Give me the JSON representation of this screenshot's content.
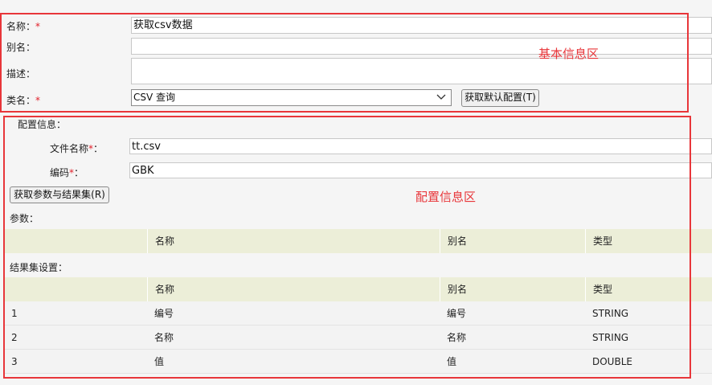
{
  "basic": {
    "name_label": "名称：",
    "name_value": "获取csv数据",
    "alias_label": "别名：",
    "alias_value": "",
    "desc_label": "描述：",
    "desc_value": "",
    "class_label": "类名：",
    "class_value": "CSV 查询",
    "default_config_button": "获取默认配置(T)",
    "required_mark": "*"
  },
  "config": {
    "section_label": "配置信息：",
    "filename_label": "文件名称",
    "filename_value": "tt.csv",
    "encoding_label": "编码",
    "encoding_value": "GBK",
    "colon": "：",
    "fetch_button": "获取参数与结果集(R)",
    "params_label": "参数：",
    "params_columns": [
      "",
      "名称",
      "别名",
      "类型"
    ],
    "result_label": "结果集设置：",
    "result_columns": [
      "",
      "名称",
      "别名",
      "类型"
    ],
    "result_rows": [
      {
        "index": "1",
        "name": "编号",
        "alias": "编号",
        "type": "STRING"
      },
      {
        "index": "2",
        "name": "名称",
        "alias": "名称",
        "type": "STRING"
      },
      {
        "index": "3",
        "name": "值",
        "alias": "值",
        "type": "DOUBLE"
      }
    ]
  },
  "annotations": {
    "basic_area": "基本信息区",
    "config_area": "配置信息区",
    "color": "#e8363a"
  },
  "icons": {
    "select_arrow": "chevron-down-icon"
  }
}
